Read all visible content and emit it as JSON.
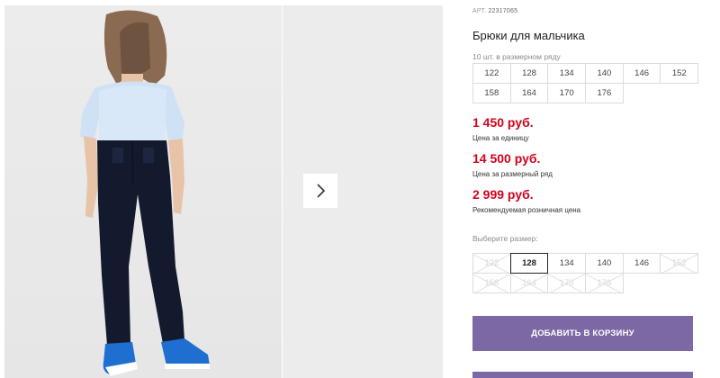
{
  "product": {
    "sku_label": "АРТ.",
    "sku_number": "22317065",
    "title": "Брюки для мальчика",
    "image_alt": "Мальчик в белой рубашке и тёмно-синих брюках, вид сзади"
  },
  "pack": {
    "label": "10 шт. в размерном ряду",
    "sizes": [
      "122",
      "128",
      "134",
      "140",
      "146",
      "152",
      "158",
      "164",
      "170",
      "176"
    ]
  },
  "prices": [
    {
      "value": "1 450 руб.",
      "caption": "Цена за единицу"
    },
    {
      "value": "14 500 руб.",
      "caption": "Цена за размерный ряд"
    },
    {
      "value": "2 999 руб.",
      "caption": "Рекомендуемая розничная цена"
    }
  ],
  "size_picker": {
    "label": "Выберите размер:",
    "sizes": [
      {
        "label": "122",
        "state": "unavailable"
      },
      {
        "label": "128",
        "state": "selected"
      },
      {
        "label": "134",
        "state": "available"
      },
      {
        "label": "140",
        "state": "available"
      },
      {
        "label": "146",
        "state": "available"
      },
      {
        "label": "152",
        "state": "unavailable"
      },
      {
        "label": "158",
        "state": "unavailable"
      },
      {
        "label": "164",
        "state": "unavailable"
      },
      {
        "label": "170",
        "state": "unavailable"
      },
      {
        "label": "176",
        "state": "unavailable"
      }
    ]
  },
  "actions": {
    "add_to_cart": "ДОБАВИТЬ В КОРЗИНУ"
  },
  "icons": {
    "next": "chevron-right-icon"
  },
  "colors": {
    "accent": "#7d68a6",
    "price": "#d0021b"
  }
}
